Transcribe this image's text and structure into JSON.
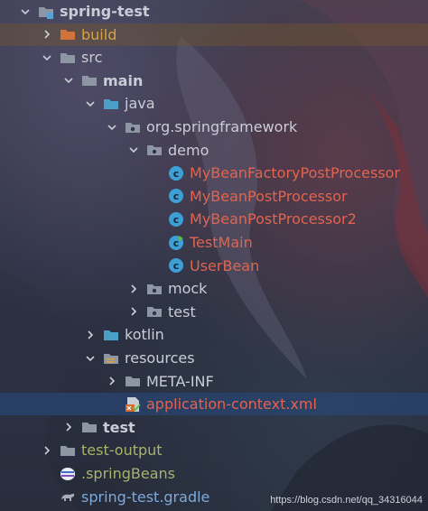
{
  "tree": [
    {
      "label": "spring-test",
      "icon": "module-folder-icon",
      "arrow": "down",
      "indent": 0,
      "style": "bold plain"
    },
    {
      "label": "build",
      "icon": "excluded-folder-icon",
      "arrow": "right",
      "indent": 1,
      "style": "orange"
    },
    {
      "label": "src",
      "icon": "folder-icon",
      "arrow": "down",
      "indent": 1,
      "style": "plain"
    },
    {
      "label": "main",
      "icon": "folder-icon",
      "arrow": "down",
      "indent": 2,
      "style": "bold plain"
    },
    {
      "label": "java",
      "icon": "source-folder-icon",
      "arrow": "down",
      "indent": 3,
      "style": "plain"
    },
    {
      "label": "org.springframework",
      "icon": "package-icon",
      "arrow": "down",
      "indent": 4,
      "style": "plain"
    },
    {
      "label": "demo",
      "icon": "package-icon",
      "arrow": "down",
      "indent": 5,
      "style": "plain"
    },
    {
      "label": "MyBeanFactoryPostProcessor",
      "icon": "class-icon",
      "arrow": "none",
      "indent": 6,
      "style": "red"
    },
    {
      "label": "MyBeanPostProcessor",
      "icon": "class-icon",
      "arrow": "none",
      "indent": 6,
      "style": "red"
    },
    {
      "label": "MyBeanPostProcessor2",
      "icon": "class-icon",
      "arrow": "none",
      "indent": 6,
      "style": "red"
    },
    {
      "label": "TestMain",
      "icon": "runnable-class-icon",
      "arrow": "none",
      "indent": 6,
      "style": "red"
    },
    {
      "label": "UserBean",
      "icon": "class-icon",
      "arrow": "none",
      "indent": 6,
      "style": "red"
    },
    {
      "label": "mock",
      "icon": "package-icon",
      "arrow": "right",
      "indent": 5,
      "style": "plain"
    },
    {
      "label": "test",
      "icon": "package-icon",
      "arrow": "right",
      "indent": 5,
      "style": "plain"
    },
    {
      "label": "kotlin",
      "icon": "source-folder-icon",
      "arrow": "right",
      "indent": 3,
      "style": "plain"
    },
    {
      "label": "resources",
      "icon": "resources-folder-icon",
      "arrow": "down",
      "indent": 3,
      "style": "plain"
    },
    {
      "label": "META-INF",
      "icon": "folder-icon",
      "arrow": "right",
      "indent": 4,
      "style": "plain"
    },
    {
      "label": "application-context.xml",
      "icon": "xml-file-icon",
      "arrow": "none",
      "indent": 4,
      "style": "red",
      "selected": true
    },
    {
      "label": "test",
      "icon": "folder-icon",
      "arrow": "right",
      "indent": 2,
      "style": "bold plain"
    },
    {
      "label": "test-output",
      "icon": "folder-icon",
      "arrow": "right",
      "indent": 1,
      "style": "olive"
    },
    {
      "label": ".springBeans",
      "icon": "springbeans-file-icon",
      "arrow": "none",
      "indent": 1,
      "style": "olive"
    },
    {
      "label": "spring-test.gradle",
      "icon": "gradle-icon",
      "arrow": "none",
      "indent": 1,
      "style": "blue"
    }
  ],
  "watermark": "https://blog.csdn.net/qq_34316044",
  "colors": {
    "folder": "#8f96a3",
    "source_folder": "#4a9fc7",
    "class": "#3c9fd6",
    "selected": "#284678",
    "build_row": "#785a28"
  }
}
